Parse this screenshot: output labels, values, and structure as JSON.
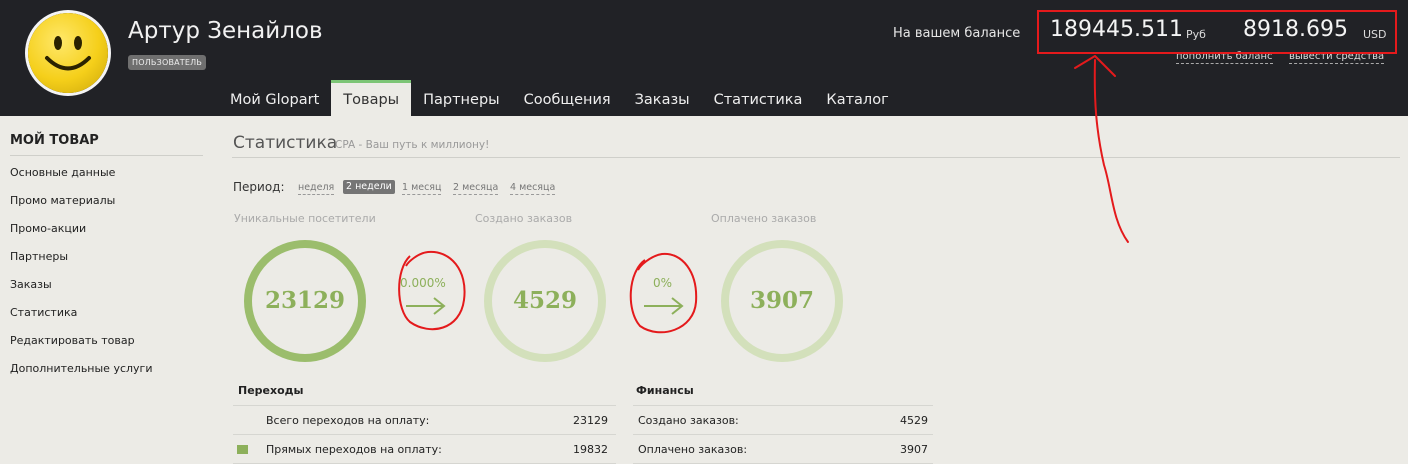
{
  "user": {
    "name": "Артур Зенайлов",
    "role": "ПОЛЬЗОВАТЕЛЬ"
  },
  "balance": {
    "label": "На вашем балансе",
    "rub_value": "189445.511",
    "rub_currency": "Руб",
    "usd_value": "8918.695",
    "usd_currency": "USD",
    "topup_link": "пополнить баланс",
    "withdraw_link": "вывести средства"
  },
  "nav": {
    "items": [
      "Мой Glopart",
      "Товары",
      "Партнеры",
      "Сообщения",
      "Заказы",
      "Статистика",
      "Каталог"
    ],
    "active_index": 1
  },
  "sidebar": {
    "title": "МОЙ ТОВАР",
    "items": [
      "Основные данные",
      "Промо материалы",
      "Промо-акции",
      "Партнеры",
      "Заказы",
      "Статистика",
      "Редактировать товар",
      "Дополнительные услуги"
    ]
  },
  "stats": {
    "title": "Статистика",
    "subtitle": "CPA - Ваш путь к миллиону!",
    "period_label": "Период:",
    "periods": [
      "неделя",
      "2 недели",
      "1 месяц",
      "2 месяца",
      "4 месяца"
    ],
    "active_period": "2 недели",
    "metrics": [
      {
        "label": "Уникальные посетители",
        "value": "23129"
      },
      {
        "label": "Создано заказов",
        "value": "4529"
      },
      {
        "label": "Оплачено заказов",
        "value": "3907"
      }
    ],
    "conversions": [
      "0.000%",
      "0%"
    ]
  },
  "transitions": {
    "title": "Переходы",
    "rows": [
      {
        "label": "Всего переходов на оплату:",
        "value": "23129"
      },
      {
        "label": "Прямых переходов на оплату:",
        "value": "19832"
      }
    ]
  },
  "finance": {
    "title": "Финансы",
    "rows": [
      {
        "label": "Создано заказов:",
        "value": "4529"
      },
      {
        "label": "Оплачено заказов:",
        "value": "3907"
      }
    ]
  },
  "colors": {
    "header_bg": "#212226",
    "page_bg": "#ecebe6",
    "accent_green": "#8db05b",
    "ring_light": "#d3e0bb",
    "annotation_red": "#e41a1c"
  }
}
